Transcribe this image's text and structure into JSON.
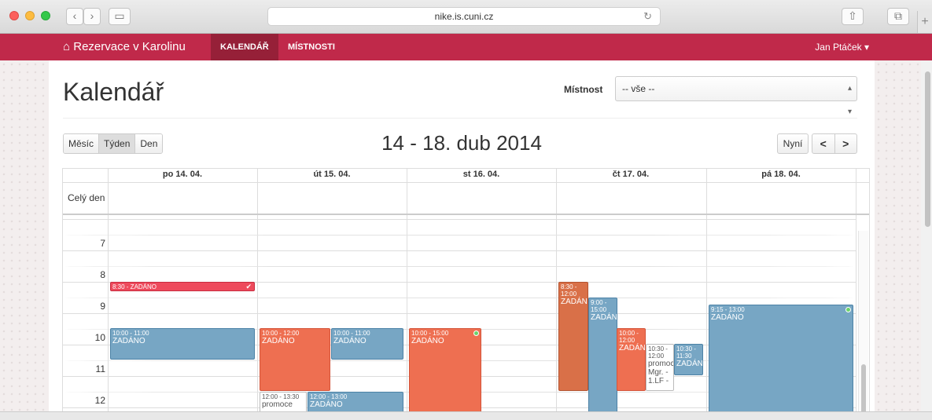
{
  "browser": {
    "url": "nike.is.cuni.cz",
    "back_icon": "chevron-left",
    "forward_icon": "chevron-right",
    "sidebar_icon": "sidebar",
    "reload_icon": "reload",
    "share_icon": "share",
    "tabs_icon": "tabs",
    "newtab_label": "+"
  },
  "navbar": {
    "brand": "Rezervace v Karolinu",
    "brand_icon": "home",
    "items": [
      {
        "label": "KALENDÁŘ",
        "active": true
      },
      {
        "label": "MÍSTNOSTI",
        "active": false
      }
    ],
    "user": "Jan Ptáček ▾"
  },
  "page": {
    "title": "Kalendář",
    "room_label": "Místnost",
    "room_value": "-- vše --"
  },
  "toolbar": {
    "views": [
      {
        "label": "Měsíc",
        "active": false
      },
      {
        "label": "Týden",
        "active": true
      },
      {
        "label": "Den",
        "active": false
      }
    ],
    "range": "14 - 18. dub 2014",
    "now_label": "Nyní",
    "prev": "<",
    "next": ">"
  },
  "calendar": {
    "days": [
      "po 14. 04.",
      "út 15. 04.",
      "st 16. 04.",
      "čt 17. 04.",
      "pá 18. 04."
    ],
    "allday_label": "Celý den",
    "hours": [
      "7",
      "8",
      "9",
      "10",
      "11",
      "12"
    ],
    "events": [
      {
        "time": "8:30 - ZADÁNO",
        "title": "",
        "color": "red",
        "day": "po"
      },
      {
        "time": "10:00 - 11:00",
        "title": "ZADÁNO",
        "color": "blue",
        "day": "po"
      },
      {
        "time": "10:00 - 12:00",
        "title": "ZADÁNO",
        "color": "orange",
        "day": "út"
      },
      {
        "time": "10:00 - 11:00",
        "title": "ZADÁNO",
        "color": "blue",
        "day": "út"
      },
      {
        "time": "12:00 - 13:30",
        "title": "promoce",
        "color": "gray",
        "day": "út"
      },
      {
        "time": "12:00 - 13:00",
        "title": "ZADÁNO",
        "color": "blue",
        "day": "út"
      },
      {
        "time": "10:00 - 15:00",
        "title": "ZADÁNO",
        "color": "orange",
        "day": "st"
      },
      {
        "time": "8:30 - 12:00",
        "title": "ZADÁN",
        "color": "dkorange",
        "day": "čt"
      },
      {
        "time": "9:00 - 15:00",
        "title": "ZADÁN",
        "color": "blue",
        "day": "čt"
      },
      {
        "time": "10:00 - 12:00",
        "title": "ZADÁN",
        "color": "orange",
        "day": "čt"
      },
      {
        "time": "10:30 - 12:00",
        "title": "promoc Mgr. - 1.LF -",
        "color": "gray",
        "day": "čt"
      },
      {
        "time": "10:30 - 11:30",
        "title": "ZADÁN",
        "color": "blue",
        "day": "čt"
      },
      {
        "time": "9:15 - 13:00",
        "title": "ZADÁNO",
        "color": "blue",
        "day": "pá"
      }
    ]
  },
  "colors": {
    "navbar": "#c0294a",
    "navbar_active": "#962038",
    "event_blue": "#77a6c4",
    "event_orange": "#ee6f51",
    "event_red": "#ee4a5c"
  }
}
